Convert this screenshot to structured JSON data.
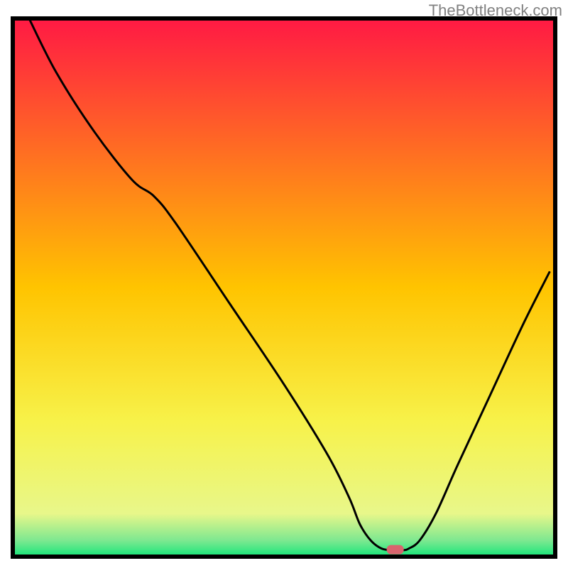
{
  "watermark": "TheBottleneck.com",
  "chart_data": {
    "type": "line",
    "title": "",
    "xlabel": "",
    "ylabel": "",
    "xlim": [
      0,
      100
    ],
    "ylim": [
      0,
      100
    ],
    "background": {
      "type": "vertical-gradient",
      "stops": [
        {
          "offset": 0,
          "color": "#ff1944"
        },
        {
          "offset": 50,
          "color": "#ffc400"
        },
        {
          "offset": 75,
          "color": "#f7f24a"
        },
        {
          "offset": 92,
          "color": "#e8f78a"
        },
        {
          "offset": 97,
          "color": "#7de890"
        },
        {
          "offset": 100,
          "color": "#15e67a"
        }
      ]
    },
    "curve": [
      {
        "x": 3.0,
        "y": 100.0
      },
      {
        "x": 8.0,
        "y": 90.0
      },
      {
        "x": 15.0,
        "y": 79.0
      },
      {
        "x": 22.0,
        "y": 70.0
      },
      {
        "x": 26.0,
        "y": 67.0
      },
      {
        "x": 30.0,
        "y": 62.0
      },
      {
        "x": 40.0,
        "y": 47.0
      },
      {
        "x": 50.0,
        "y": 32.0
      },
      {
        "x": 58.0,
        "y": 19.0
      },
      {
        "x": 62.0,
        "y": 11.0
      },
      {
        "x": 64.0,
        "y": 6.0
      },
      {
        "x": 66.0,
        "y": 3.0
      },
      {
        "x": 68.0,
        "y": 1.5
      },
      {
        "x": 70.0,
        "y": 1.2
      },
      {
        "x": 72.0,
        "y": 1.2
      },
      {
        "x": 73.0,
        "y": 1.5
      },
      {
        "x": 75.0,
        "y": 3.0
      },
      {
        "x": 78.0,
        "y": 8.0
      },
      {
        "x": 82.0,
        "y": 17.0
      },
      {
        "x": 88.0,
        "y": 30.0
      },
      {
        "x": 94.0,
        "y": 43.0
      },
      {
        "x": 99.0,
        "y": 53.0
      }
    ],
    "marker": {
      "x": 70.5,
      "y": 1.3,
      "color": "#d9646e"
    },
    "frame": true
  }
}
